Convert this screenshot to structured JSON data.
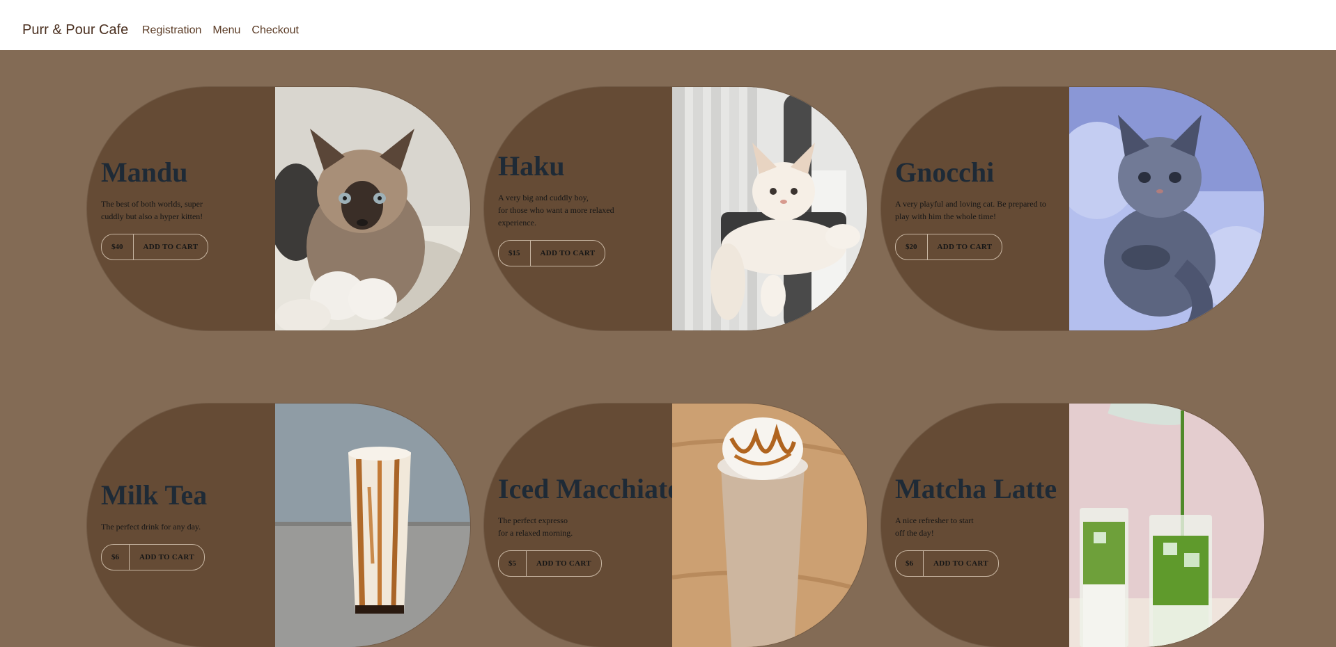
{
  "nav": {
    "brand": "Purr & Pour Cafe",
    "links": [
      "Registration",
      "Menu",
      "Checkout"
    ]
  },
  "cards": [
    {
      "title": "Mandu",
      "desc": "The best of both worlds, super\ncuddly but also a hyper kitten!",
      "price": "$40",
      "button": "ADD TO CART",
      "image": "ragdoll-kitten-photo"
    },
    {
      "title": "Haku",
      "desc": "A very big and cuddly boy,\nfor those who want a more relaxed\nexperience.",
      "price": "$15",
      "button": "ADD TO CART",
      "image": "white-cat-on-tower-photo"
    },
    {
      "title": "Gnocchi",
      "desc": "A very playful and loving cat. Be prepared to\nplay with him the whole time!",
      "price": "$20",
      "button": "ADD TO CART",
      "image": "grey-fluffy-cat-photo"
    },
    {
      "title": "Milk Tea",
      "desc": "The perfect drink for any day.",
      "price": "$6",
      "button": "ADD TO CART",
      "image": "milk-tea-glass-photo"
    },
    {
      "title": "Iced Macchiato",
      "desc": "The perfect expresso\nfor a relaxed morning.",
      "price": "$5",
      "button": "ADD TO CART",
      "image": "iced-macchiato-cup-photo"
    },
    {
      "title": "Matcha Latte",
      "desc": "A nice refresher to start\noff the day!",
      "price": "$6",
      "button": "ADD TO CART",
      "image": "matcha-latte-glasses-photo"
    }
  ],
  "colors": {
    "page_bg": "#836b55",
    "card_bg": "#654b35",
    "title": "#1e2a36",
    "border": "#c9b7a3",
    "brand": "#4a2f1f"
  }
}
